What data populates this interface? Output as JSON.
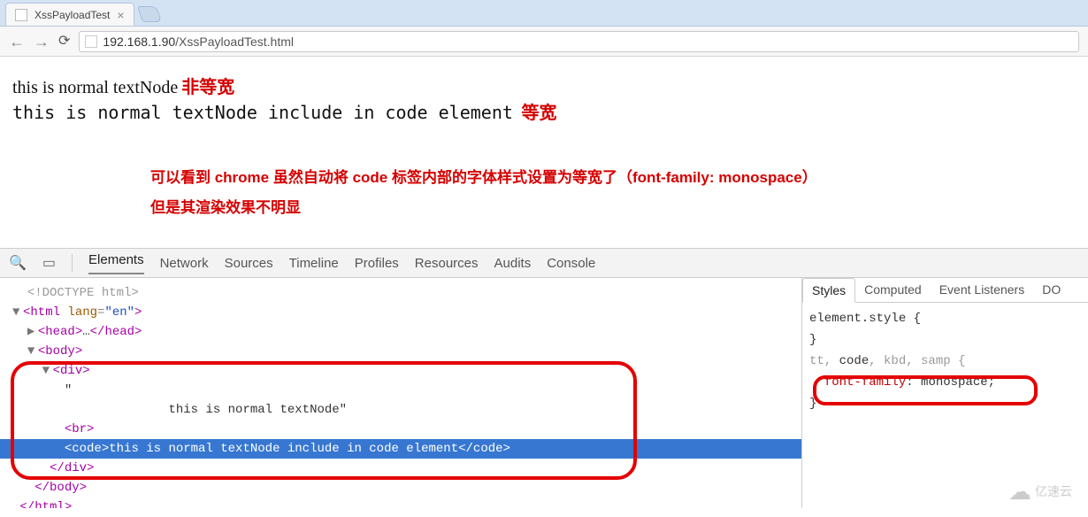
{
  "browser": {
    "tab_title": "XssPayloadTest",
    "url_host": "192.168.1.90",
    "url_path": "/XssPayloadTest.html"
  },
  "page": {
    "line1_text": "this is normal textNode",
    "line1_anno": "非等宽",
    "line2_text": "this is normal textNode include in code element",
    "line2_anno": "等宽",
    "comment_line1": "可以看到 chrome 虽然自动将 code 标签内部的字体样式设置为等宽了（font-family: monospace）",
    "comment_line2": "但是其渲染效果不明显"
  },
  "devtools": {
    "tabs": [
      "Elements",
      "Network",
      "Sources",
      "Timeline",
      "Profiles",
      "Resources",
      "Audits",
      "Console"
    ],
    "active_tab": "Elements",
    "dom": {
      "doctype": "<!DOCTYPE html>",
      "html_open": "<html lang=\"en\">",
      "head": "<head>…</head>",
      "body_open": "<body>",
      "div_open": "<div>",
      "quote_line": "\"",
      "text_line": "            this is normal textNode\"",
      "br": "<br>",
      "code_line": "<code>this is normal textNode include in code element</code>",
      "div_close": "</div>",
      "body_close": "</body>",
      "html_close": "</html>"
    },
    "styles": {
      "tabs": [
        "Styles",
        "Computed",
        "Event Listeners",
        "DO"
      ],
      "active_tab": "Styles",
      "rule1_selector": "element.style {",
      "rule1_close": "}",
      "rule2_selector_dim": "tt, ",
      "rule2_selector_main": "code",
      "rule2_selector_tail": ", kbd, samp {",
      "rule2_prop": "font-family",
      "rule2_val": "monospace;",
      "rule2_close": "}"
    }
  },
  "watermark": "亿速云"
}
